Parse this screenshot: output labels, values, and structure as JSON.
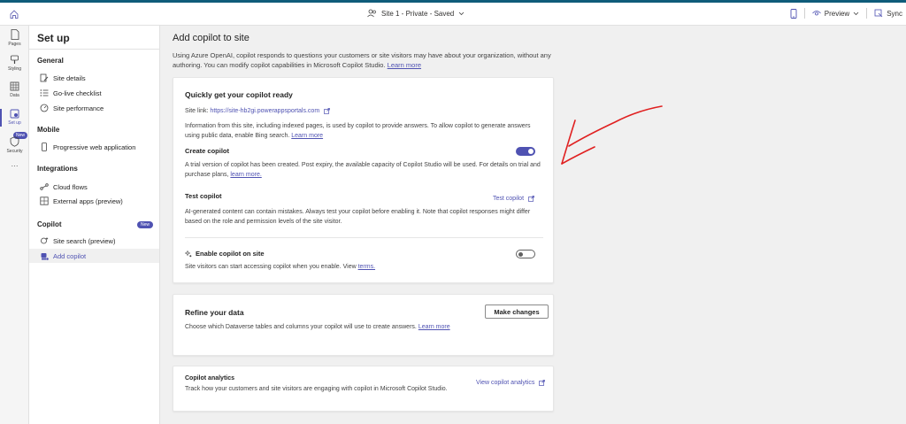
{
  "topbar": {
    "site_title": "Site 1 - Private - Saved",
    "preview_label": "Preview",
    "sync_label": "Sync"
  },
  "rail": {
    "pages": "Pages",
    "styling": "Styling",
    "data": "Data",
    "setup": "Set up",
    "security": "Security",
    "new_badge": "New",
    "more": "···"
  },
  "sidebar": {
    "title": "Set up",
    "general": "General",
    "site_details": "Site details",
    "go_live": "Go-live checklist",
    "site_performance": "Site performance",
    "mobile": "Mobile",
    "pwa": "Progressive web application",
    "integrations": "Integrations",
    "cloud_flows": "Cloud flows",
    "external_apps": "External apps (preview)",
    "copilot": "Copilot",
    "copilot_new": "New",
    "site_search": "Site search (preview)",
    "add_copilot": "Add copilot"
  },
  "main": {
    "title": "Add copilot to site",
    "description": "Using Azure OpenAI, copilot responds to questions your customers or site visitors may have about your organization, without any authoring. You can modify copilot capabilities in Microsoft Copilot Studio.",
    "learn_more": "Learn more"
  },
  "card1": {
    "title": "Quickly get your copilot ready",
    "site_link_label": "Site link:",
    "site_link": "https://site-hb2gi.powerappsportals.com",
    "info": "Information from this site, including indexed pages, is used by copilot to provide answers. To allow copilot to generate answers using public data, enable Bing search.",
    "info_link": "Learn more",
    "create_label": "Create copilot",
    "create_text": "A trial version of copilot has been created. Post expiry, the available capacity of Copilot Studio will be used. For details on trial and purchase plans,",
    "create_link": "learn more.",
    "test_label": "Test copilot",
    "test_link": "Test copilot",
    "test_text": "AI-generated content can contain mistakes. Always test your copilot before enabling it. Note that copilot responses might differ based on the role and permission levels of the site visitor.",
    "enable_label": "Enable copilot on site",
    "enable_text": "Site visitors can start accessing copilot when you enable. View",
    "enable_link": "terms."
  },
  "card2": {
    "title": "Refine your data",
    "button": "Make changes",
    "text": "Choose which Dataverse tables and columns your copilot will use to create answers.",
    "link": "Learn more"
  },
  "card3": {
    "title": "Copilot analytics",
    "text": "Track how your customers and site visitors are engaging with copilot in Microsoft Copilot Studio.",
    "link": "View copilot analytics"
  },
  "toggles": {
    "create_copilot_on": true,
    "enable_copilot_on": false
  },
  "colors": {
    "accent": "#4f52b2",
    "annotation": "#e02020"
  }
}
